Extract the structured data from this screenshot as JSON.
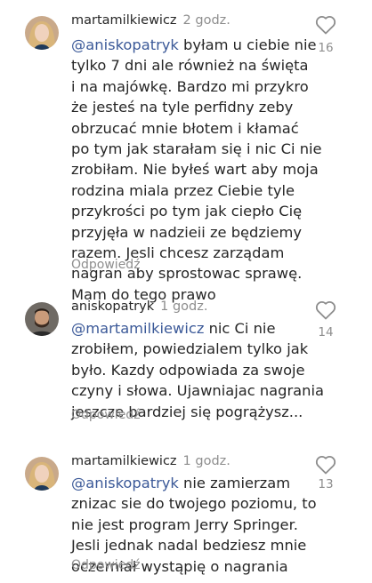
{
  "comments": [
    {
      "username": "martamilkiewicz",
      "time": "2 godz.",
      "mention": "@aniskopatryk",
      "lines": [
        " byłam u ciebie nie",
        "tylko 7 dni ale również na święta",
        "i na majówkę. Bardzo mi przykro",
        "że jesteś na tyle perfidny zeby",
        "obrzucać mnie błotem i kłamać",
        "po tym jak starałam się i nic Ci nie",
        "zrobiłam. Nie byłeś wart aby moja",
        "rodzina miala przez Ciebie tyle",
        "przykrości po tym jak ciepło Cię",
        "przyjęła w nadzieii ze będziemy",
        "razem. Jesli chcesz zarządam",
        "nagran aby sprostowac sprawę.",
        "Mam do tego prawo"
      ],
      "reply_label": "Odpowiedź",
      "likes": "16",
      "avatar": "woman-blonde-avatar"
    },
    {
      "username": "aniskopatryk",
      "time": "1 godz.",
      "mention": "@martamilkiewicz",
      "lines": [
        " nic Ci nie",
        "zrobiłem, powiedzialem tylko jak",
        "było. Kazdy odpowiada za swoje",
        "czyny i słowa. Ujawniajac nagrania",
        "jeszcze bardziej się pogrążysz..."
      ],
      "reply_label": "Odpowiedź",
      "likes": "14",
      "avatar": "man-beard-avatar"
    },
    {
      "username": "martamilkiewicz",
      "time": "1 godz.",
      "mention": "@aniskopatryk",
      "lines": [
        " nie zamierzam",
        "znizac sie do twojego poziomu, to",
        "nie jest program Jerry Springer.",
        "Jesli jednak nadal bedziesz mnie",
        "oczerniał wystąpię o nagrania"
      ],
      "reply_label": "Odpowiedź",
      "likes": "13",
      "avatar": "woman-blonde-avatar"
    }
  ],
  "colors": {
    "mention": "#3b5998",
    "text": "#262626",
    "muted": "#8e8e8e"
  }
}
